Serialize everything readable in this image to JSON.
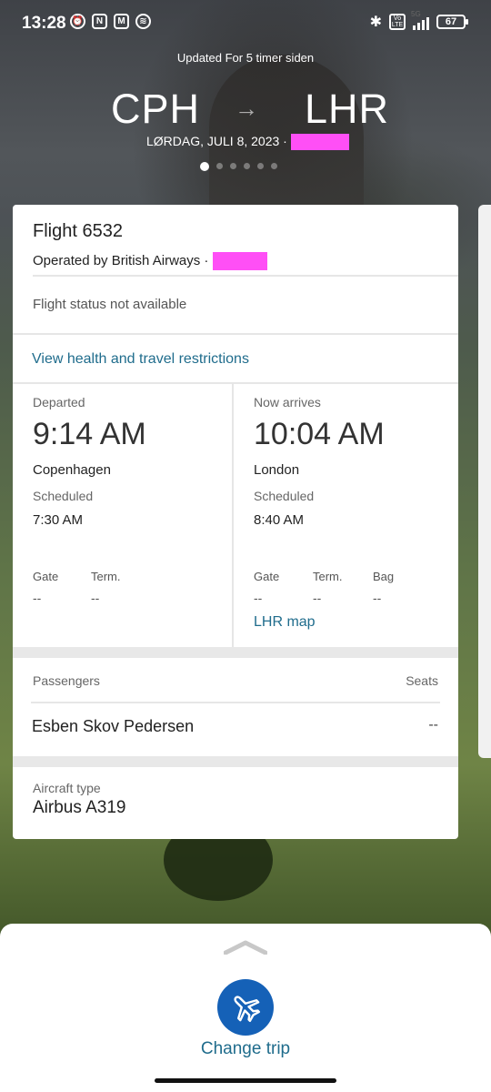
{
  "status_bar": {
    "time": "13:28",
    "battery": "67",
    "network": "5G"
  },
  "header": {
    "updated": "Updated For 5 timer siden",
    "from": "CPH",
    "arrow": "→",
    "to": "LHR",
    "date": "LØRDAG, JULI 8, 2023 ·",
    "page_count": 6,
    "active_page": 1
  },
  "flight": {
    "title": "Flight 6532",
    "operated_by": "Operated by British Airways ·",
    "status": "Flight status not available",
    "restrictions_link": "View health and travel restrictions"
  },
  "departure": {
    "label": "Departed",
    "time": "9:14 AM",
    "city": "Copenhagen",
    "scheduled_label": "Scheduled",
    "scheduled_time": "7:30 AM",
    "gate_label": "Gate",
    "gate_value": "--",
    "term_label": "Term.",
    "term_value": "--"
  },
  "arrival": {
    "label": "Now arrives",
    "time": "10:04 AM",
    "city": "London",
    "scheduled_label": "Scheduled",
    "scheduled_time": "8:40 AM",
    "gate_label": "Gate",
    "gate_value": "--",
    "term_label": "Term.",
    "term_value": "--",
    "bag_label": "Bag",
    "bag_value": "--",
    "map_link": "LHR map"
  },
  "passengers": {
    "header": "Passengers",
    "seats_header": "Seats",
    "list": [
      {
        "name": "Esben Skov Pedersen",
        "seat": "--"
      }
    ]
  },
  "aircraft": {
    "label": "Aircraft type",
    "value": "Airbus A319"
  },
  "bottom_sheet": {
    "change_trip": "Change trip"
  },
  "colors": {
    "link": "#1f6c8c",
    "fab": "#1561b7",
    "redaction": "#ff4ff6"
  }
}
